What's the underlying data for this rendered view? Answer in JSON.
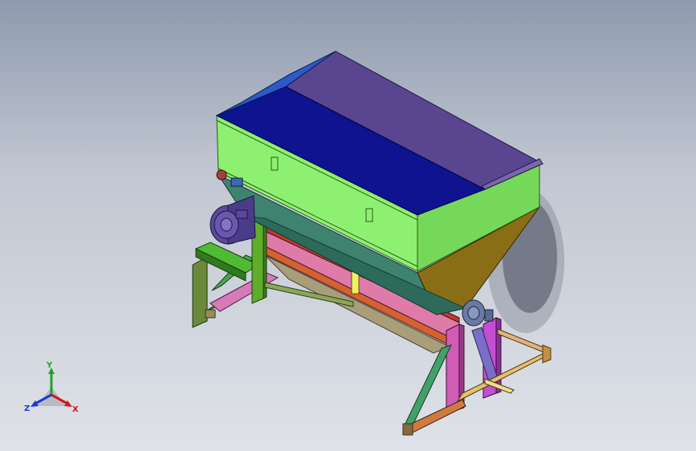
{
  "viewport": {
    "background_top": "#8e9aae",
    "background_bottom": "#dfe2e8"
  },
  "model": {
    "parts": [
      "hopper-lid",
      "hopper-body",
      "hopper-funnel",
      "conveyor-frame",
      "drive-motor",
      "bearing-unit",
      "support-legs",
      "motor-base"
    ]
  },
  "triad": {
    "x_label": "X",
    "y_label": "Y",
    "z_label": "Z",
    "x_color": "#d01818",
    "y_color": "#1fa31f",
    "z_color": "#2038d0"
  }
}
